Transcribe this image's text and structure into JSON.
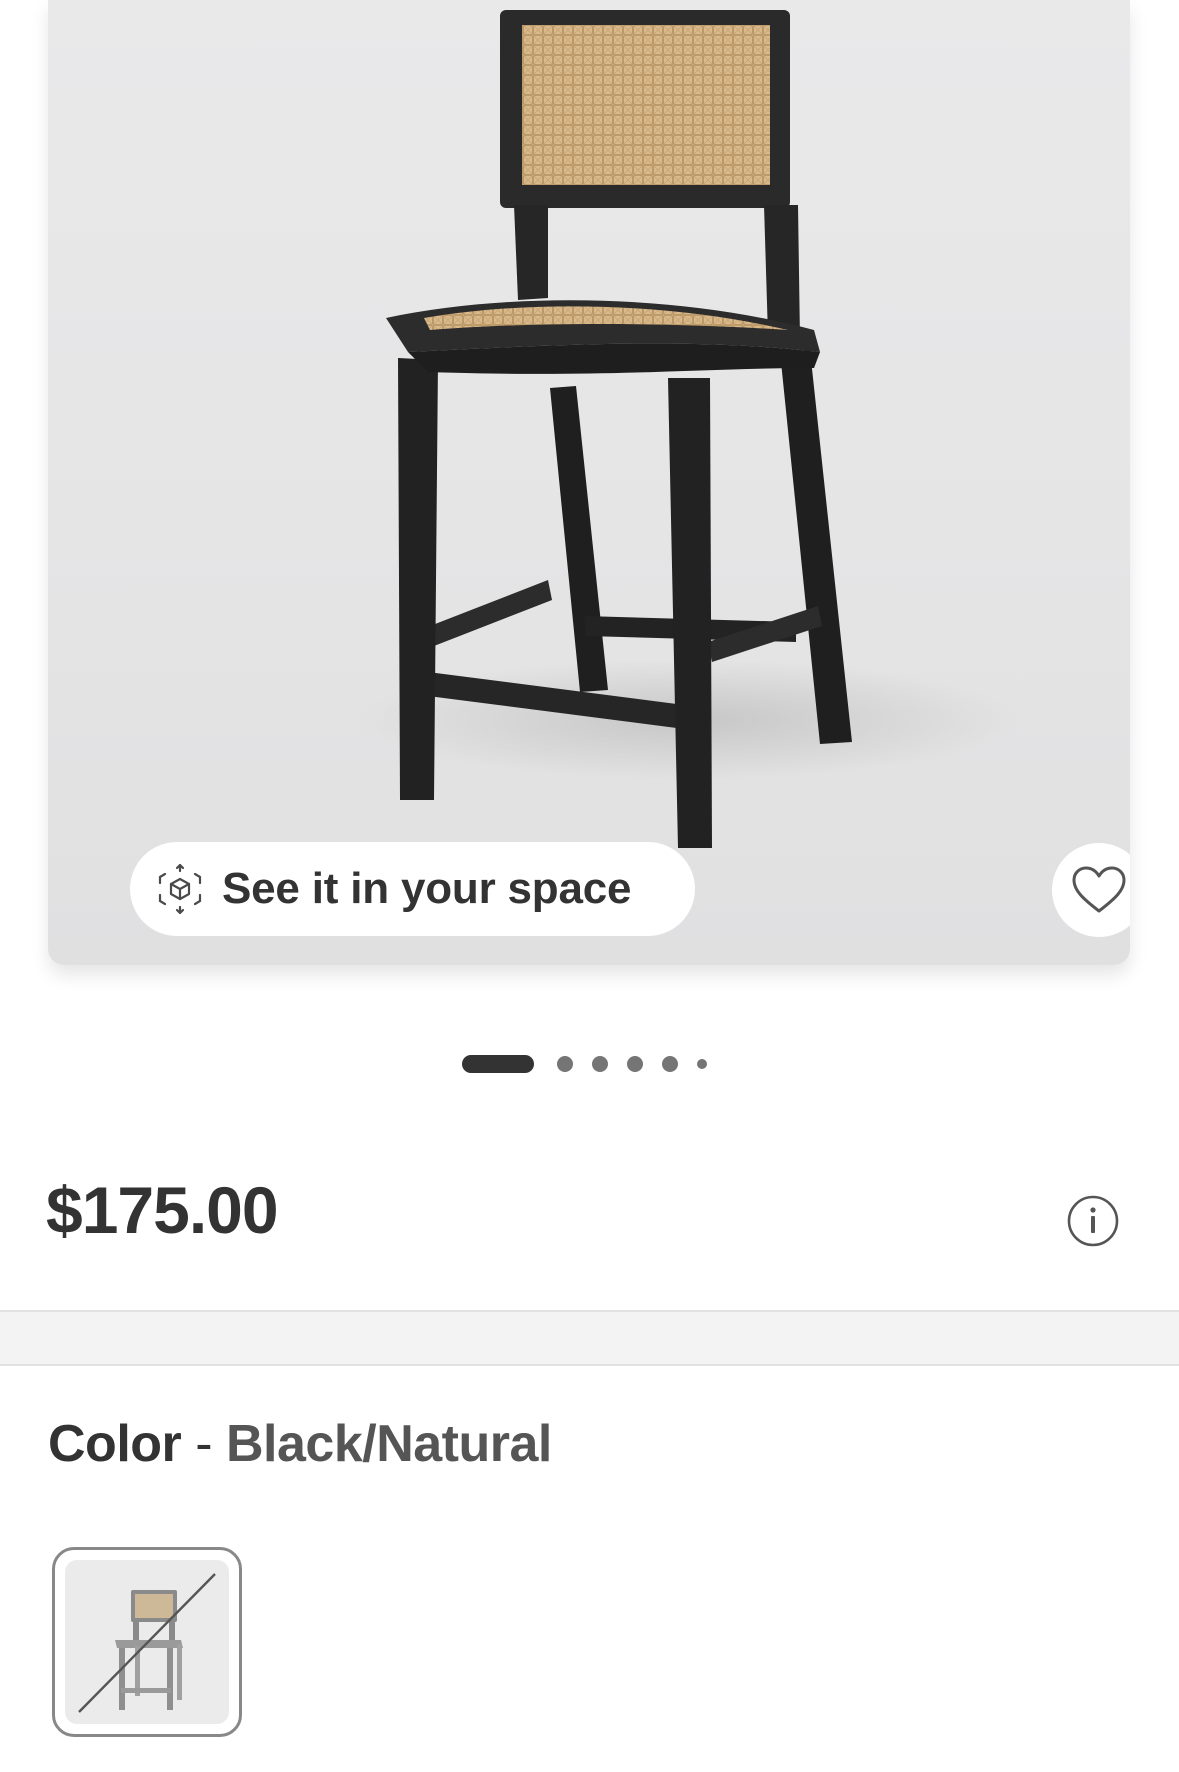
{
  "product_image": {
    "carousel_total": 6,
    "carousel_active_index": 0
  },
  "ar_button": {
    "label": "See it in your space",
    "icon": "ar-cube-icon"
  },
  "favorite_button": {
    "icon": "heart-outline-icon"
  },
  "price": {
    "amount": "$175.00",
    "info_icon": "info-circle-icon"
  },
  "color": {
    "label": "Color",
    "separator": " - ",
    "value": "Black/Natural",
    "swatches": [
      {
        "name": "Black/Natural",
        "selected": true,
        "unavailable": true
      }
    ]
  },
  "colors": {
    "text": "#333333",
    "muted_text": "#555555",
    "dot_active": "#333333",
    "dot_inactive": "#757575",
    "wood": "#2b2b2b",
    "rattan": "#d8b98a"
  }
}
